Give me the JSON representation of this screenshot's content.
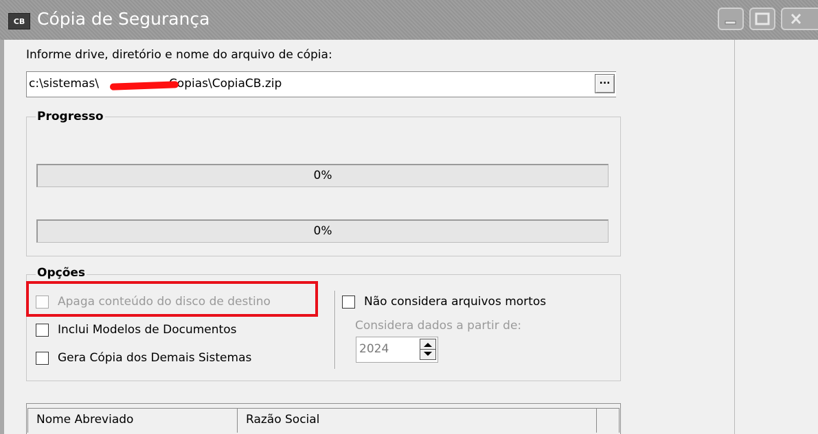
{
  "window": {
    "icon_text": "CB",
    "title": "Cópia de Segurança"
  },
  "file": {
    "label": "Informe drive, diretório e nome do arquivo de cópia:",
    "path_prefix": "c:\\sistemas\\",
    "path_suffix": "Copias\\CopiaCB.zip",
    "browse_label": "..."
  },
  "progress": {
    "title": "Progresso",
    "bars": [
      {
        "value": 0,
        "label": "0%"
      },
      {
        "value": 0,
        "label": "0%"
      }
    ]
  },
  "options": {
    "title": "Opções",
    "checkboxes": [
      {
        "label": "Apaga conteúdo do disco de destino",
        "checked": false,
        "enabled": false
      },
      {
        "label": "Inclui Modelos de Documentos",
        "checked": false,
        "enabled": true
      },
      {
        "label": "Gera Cópia dos Demais Sistemas",
        "checked": false,
        "enabled": true
      },
      {
        "label": "Não considera arquivos mortos",
        "checked": false,
        "enabled": true
      }
    ],
    "from_label": "Considera dados a partir de:",
    "year": "2024"
  },
  "table": {
    "columns": [
      "Nome Abreviado",
      "Razão Social"
    ]
  },
  "colors": {
    "highlight": "#e8101a",
    "redaction": "#ff1010"
  }
}
